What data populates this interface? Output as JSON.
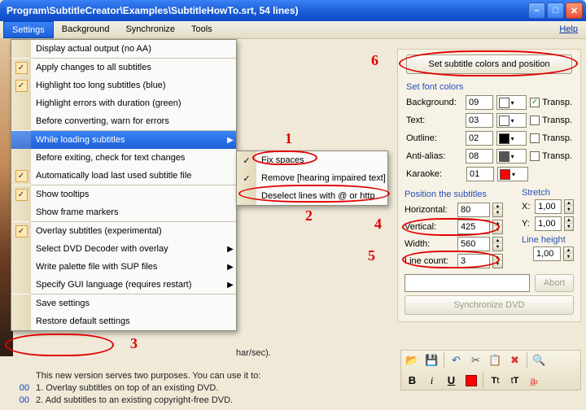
{
  "window": {
    "title": "Program\\SubtitleCreator\\Examples\\SubtitleHowTo.srt, 54 lines)"
  },
  "menubar": {
    "items": [
      "Settings",
      "Background",
      "Synchronize",
      "Tools"
    ],
    "help": "Help"
  },
  "settings_menu": {
    "items": [
      {
        "label": "Display actual output (no AA)",
        "checked": false
      },
      {
        "label": "Apply changes to all subtitles",
        "checked": true
      },
      {
        "label": "Highlight too long subtitles (blue)",
        "checked": true
      },
      {
        "label": "Highlight errors with duration (green)",
        "checked": false
      },
      {
        "label": "Before converting, warn for errors",
        "checked": false
      },
      {
        "label": "While loading subtitles",
        "checked": false,
        "submenu": true,
        "hover": true
      },
      {
        "label": "Before exiting, check for text changes",
        "checked": false
      },
      {
        "label": "Automatically load last used subtitle file",
        "checked": true
      },
      {
        "label": "Show tooltips",
        "checked": true
      },
      {
        "label": "Show frame markers",
        "checked": false
      },
      {
        "label": "Overlay subtitles (experimental)",
        "checked": true
      },
      {
        "label": "Select DVD Decoder with overlay",
        "submenu": true
      },
      {
        "label": "Write palette file with SUP files",
        "submenu": true
      },
      {
        "label": "Specify GUI language (requires restart)",
        "submenu": true
      },
      {
        "label": "Save settings"
      },
      {
        "label": "Restore default settings"
      }
    ],
    "separators_after": [
      0,
      4,
      7,
      9,
      13
    ]
  },
  "submenu": {
    "items": [
      {
        "label": "Fix spaces",
        "checked": true
      },
      {
        "label": "Remove [hearing impaired text]",
        "checked": true
      },
      {
        "label": "Deselect lines with @ or http",
        "checked": false
      }
    ]
  },
  "right": {
    "bigbutton": "Set subtitle colors and position",
    "font_section": "Set font colors",
    "rows": {
      "background": {
        "label": "Background:",
        "num": "09",
        "swatch": "#ffffff",
        "transp": true
      },
      "text": {
        "label": "Text:",
        "num": "03",
        "swatch": "#ffffff",
        "transp": false
      },
      "outline": {
        "label": "Outline:",
        "num": "02",
        "swatch": "#000000",
        "transp": false
      },
      "antialias": {
        "label": "Anti-alias:",
        "num": "08",
        "swatch": "#555555",
        "transp": false
      },
      "karaoke": {
        "label": "Karaoke:",
        "num": "01",
        "swatch": "#ff0000",
        "transp_label": false
      }
    },
    "transp_label": "Transp.",
    "pos_section": "Position the subtitles",
    "stretch_section": "Stretch",
    "lineheight_section": "Line height",
    "pos": {
      "horizontal": {
        "label": "Horizontal:",
        "val": "80"
      },
      "vertical": {
        "label": "Vertical:",
        "val": "425"
      },
      "width": {
        "label": "Width:",
        "val": "560"
      },
      "linecount": {
        "label": "Line count:",
        "val": "3"
      }
    },
    "stretch": {
      "x": "X:",
      "xval": "1,00",
      "y": "Y:",
      "yval": "1,00"
    },
    "lineheight": "1,00",
    "abort": "Abort",
    "sync": "Synchronize DVD"
  },
  "toolbar_icons": {
    "row1": [
      "open",
      "save",
      "undo",
      "cut",
      "paste",
      "delete",
      "search"
    ],
    "row2": [
      "B",
      "i",
      "U",
      "color",
      "Tt",
      "tT",
      "at"
    ]
  },
  "charsec_text": "har/sec).",
  "bottom": {
    "lines": [
      {
        "n": "",
        "t": "This new version serves two purposes. You can use it to:"
      },
      {
        "n": "00",
        "t": "1. Overlay subtitles on top of an existing DVD."
      },
      {
        "n": "00",
        "t": "2. Add subtitles to an existing copyright-free DVD."
      }
    ]
  },
  "anno": {
    "n1": "1",
    "n2": "2",
    "n3": "3",
    "n4": "4",
    "n5": "5",
    "n6": "6"
  }
}
